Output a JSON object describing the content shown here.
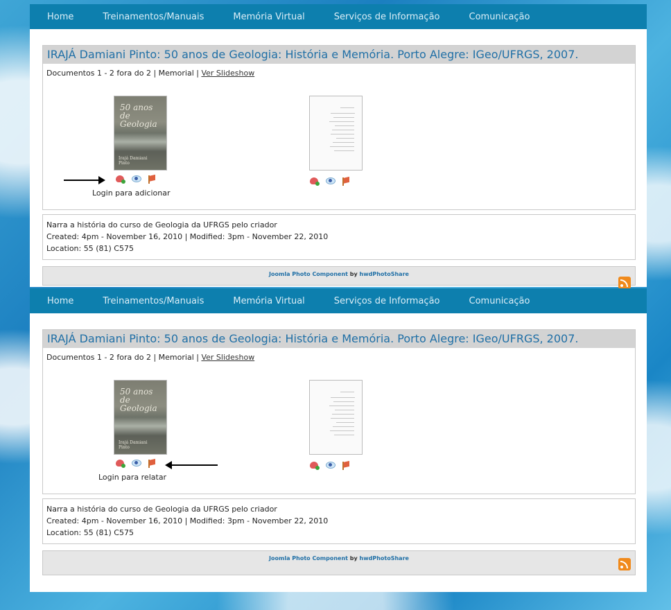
{
  "nav": {
    "items": [
      "Home",
      "Treinamentos/Manuais",
      "Memória Virtual",
      "Serviços de Informação",
      "Comunicação"
    ]
  },
  "album": {
    "title": "IRAJÁ Damiani Pinto: 50 anos de Geologia: História e Memória. Porto Alegre: IGeo/UFRGS, 2007.",
    "doc_count": "Documentos 1 - 2 fora do 2 | Memorial | ",
    "slideshow_link": "Ver Slideshow",
    "cover_title": "50 anos de Geologia",
    "cover_author": "Irajá Damiani Pinto",
    "icons": [
      "favourite-heart-icon",
      "view-eye-icon",
      "report-flag-icon"
    ]
  },
  "panels": [
    {
      "login_label": "Login para adicionar"
    },
    {
      "login_label": "Login para relatar"
    }
  ],
  "info": {
    "description": "Narra a história do curso de Geologia da UFRGS pelo criador",
    "created_modified": "Created: 4pm - November 16, 2010 | Modified: 3pm - November 22, 2010",
    "location": "Location: 55 (81) C575"
  },
  "footer": {
    "component": "Joomla Photo Component",
    "by": " by ",
    "brand": "hwdPhotoShare"
  }
}
